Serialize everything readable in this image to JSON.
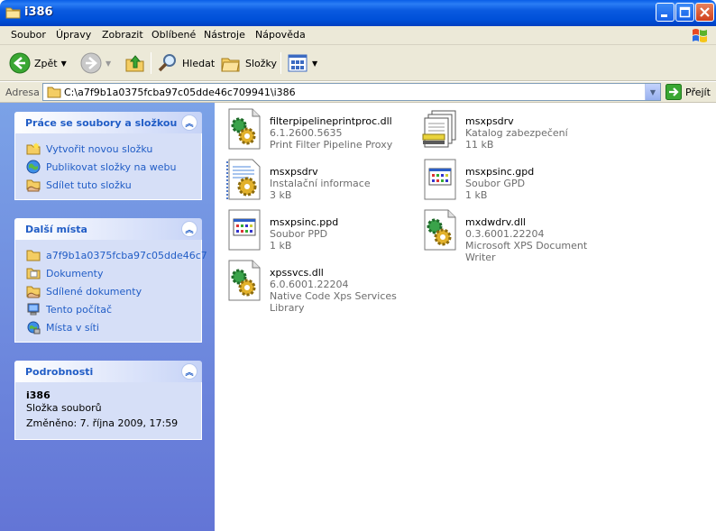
{
  "window": {
    "title": "i386",
    "icon": "folder-icon"
  },
  "menu": [
    "Soubor",
    "Úpravy",
    "Zobrazit",
    "Oblíbené",
    "Nástroje",
    "Nápověda"
  ],
  "toolbar": {
    "back": "Zpět",
    "search": "Hledat",
    "folders": "Složky"
  },
  "address": {
    "label": "Adresa",
    "path": "C:\\a7f9b1a0375fcba97c05dde46c709941\\i386",
    "go": "Přejít"
  },
  "tasks_panel": {
    "title": "Práce se soubory a složkou",
    "items": [
      "Vytvořit novou složku",
      "Publikovat složky na webu",
      "Sdílet tuto složku"
    ]
  },
  "places_panel": {
    "title": "Další místa",
    "items": [
      "a7f9b1a0375fcba97c05dde46c7",
      "Dokumenty",
      "Sdílené dokumenty",
      "Tento počítač",
      "Místa v síti"
    ]
  },
  "details_panel": {
    "title": "Podrobnosti",
    "name": "i386",
    "type": "Složka souborů",
    "modified": "Změněno: 7. října 2009, 17:59"
  },
  "files": [
    {
      "name": "filterpipelineprintproc.dll",
      "line1": "6.1.2600.5635",
      "line2": "Print Filter Pipeline Proxy",
      "icon": "dll-gear-icon"
    },
    {
      "name": "msxpsdrv",
      "line1": "Katalog zabezpečení",
      "line2": "11 kB",
      "icon": "security-catalog-icon"
    },
    {
      "name": "msxpsdrv",
      "line1": "Instalační informace",
      "line2": "3 kB",
      "icon": "setup-info-icon"
    },
    {
      "name": "msxpsinc.gpd",
      "line1": "Soubor GPD",
      "line2": "1 kB",
      "icon": "generic-file-icon"
    },
    {
      "name": "msxpsinc.ppd",
      "line1": "Soubor PPD",
      "line2": "1 kB",
      "icon": "generic-file-icon"
    },
    {
      "name": "mxdwdrv.dll",
      "line1": "0.3.6001.22204",
      "line2": "Microsoft XPS Document Writer",
      "icon": "dll-gear-icon"
    },
    {
      "name": "xpssvcs.dll",
      "line1": "6.0.6001.22204",
      "line2": "Native Code Xps Services Library",
      "icon": "dll-gear-icon"
    }
  ],
  "colors": {
    "titlebar": "#0054e3",
    "taskpane": "#6f8de0",
    "link": "#215dc6"
  }
}
